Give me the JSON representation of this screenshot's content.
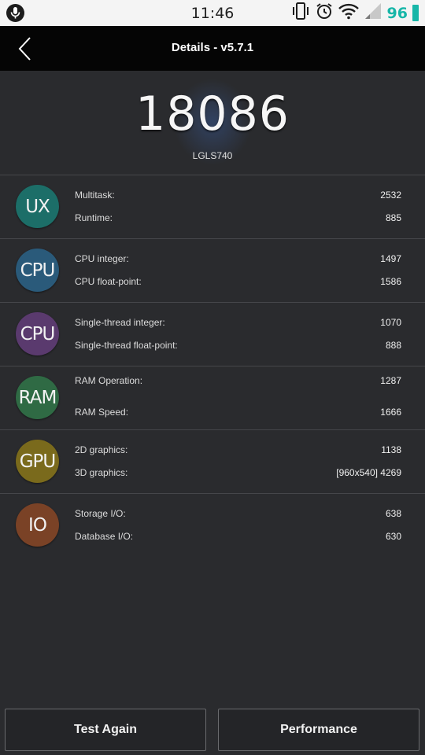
{
  "status_bar": {
    "time": "11:46",
    "battery": "96"
  },
  "header": {
    "title": "Details - v5.7.1"
  },
  "score": {
    "value": "18086",
    "device": "LGLS740"
  },
  "categories": [
    {
      "badge": "UX",
      "color": "#1c6e68",
      "items": [
        {
          "label": "Multitask:",
          "value": "2532"
        },
        {
          "label": "Runtime:",
          "value": "885"
        }
      ]
    },
    {
      "badge": "CPU",
      "color": "#2a5a7a",
      "items": [
        {
          "label": "CPU integer:",
          "value": "1497"
        },
        {
          "label": "CPU float-point:",
          "value": "1586"
        }
      ]
    },
    {
      "badge": "CPU",
      "color": "#5a3a6e",
      "items": [
        {
          "label": "Single-thread integer:",
          "value": "1070"
        },
        {
          "label": "Single-thread float-point:",
          "value": "888"
        }
      ]
    },
    {
      "badge": "RAM",
      "color": "#2f6a44",
      "items": [
        {
          "label": "RAM Operation:",
          "value": "1287"
        },
        {
          "label": "RAM Speed:",
          "value": "1666"
        }
      ]
    },
    {
      "badge": "GPU",
      "color": "#7a6a1c",
      "items": [
        {
          "label": "2D graphics:",
          "value": "1138"
        },
        {
          "label": "3D graphics:",
          "value": "[960x540] 4269"
        }
      ]
    },
    {
      "badge": "IO",
      "color": "#7a4226",
      "items": [
        {
          "label": "Storage I/O:",
          "value": "638"
        },
        {
          "label": "Database I/O:",
          "value": "630"
        }
      ]
    }
  ],
  "buttons": {
    "test_again": "Test Again",
    "performance": "Performance"
  }
}
